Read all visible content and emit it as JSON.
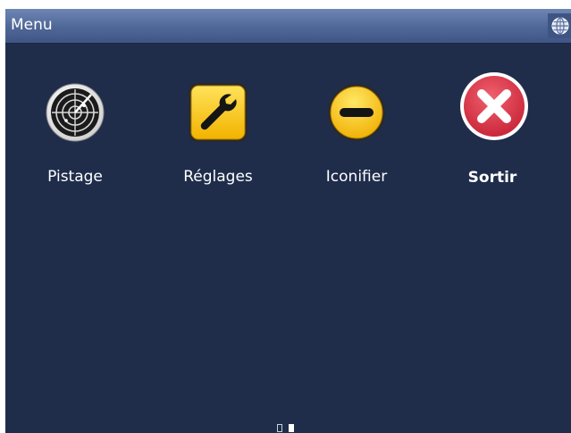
{
  "titlebar": {
    "title": "Menu",
    "globe_icon": "globe-icon"
  },
  "menu": {
    "items": [
      {
        "label": "Pistage",
        "icon": "radar-icon"
      },
      {
        "label": "Réglages",
        "icon": "wrench-icon"
      },
      {
        "label": "Iconifier",
        "icon": "minimize-icon"
      },
      {
        "label": "Sortir",
        "icon": "close-icon"
      }
    ]
  },
  "pager": {
    "pages": 2,
    "current": 2
  },
  "colors": {
    "background": "#1f2d4b",
    "titlebar": "#4f6797",
    "accent_yellow": "#f5c400",
    "exit_red": "#d42a3c"
  }
}
